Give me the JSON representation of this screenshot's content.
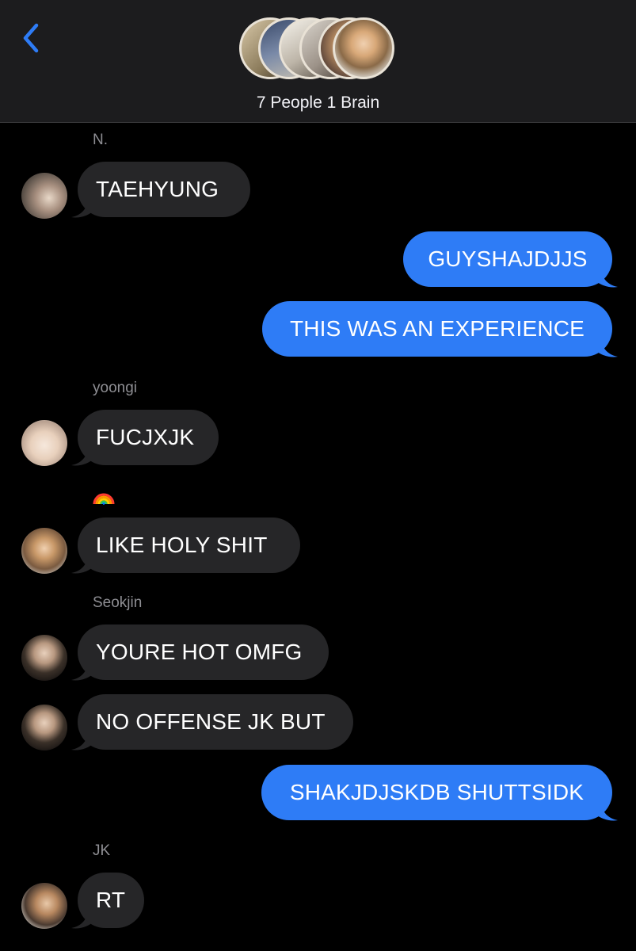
{
  "header": {
    "back_icon": "chevron-left-icon",
    "group_name": "7 People 1 Brain",
    "accent_color": "#2e7cf6"
  },
  "messages": [
    {
      "sender": "N.",
      "text": "TAEHYUNG",
      "direction": "incoming"
    },
    {
      "text": "GUYSHAJDJJS",
      "direction": "outgoing"
    },
    {
      "text": "THIS WAS AN EXPERIENCE",
      "direction": "outgoing"
    },
    {
      "sender": "yoongi",
      "text": "FUCJXJK",
      "direction": "incoming"
    },
    {
      "sender_icon": "rainbow-emoji",
      "text": "LIKE HOLY SHIT",
      "direction": "incoming"
    },
    {
      "sender": "Seokjin",
      "text": "YOURE HOT OMFG",
      "direction": "incoming"
    },
    {
      "text": "NO OFFENSE JK BUT",
      "direction": "incoming"
    },
    {
      "text": "SHAKJDJSKDB SHUTTSIDK",
      "direction": "outgoing"
    },
    {
      "sender": "JK",
      "text": "RT",
      "direction": "incoming"
    }
  ],
  "colors": {
    "incoming_bubble": "#262628",
    "outgoing_bubble": "#2e7cf6",
    "header_bg": "#1c1c1e",
    "sender_label": "#8e8e93"
  }
}
